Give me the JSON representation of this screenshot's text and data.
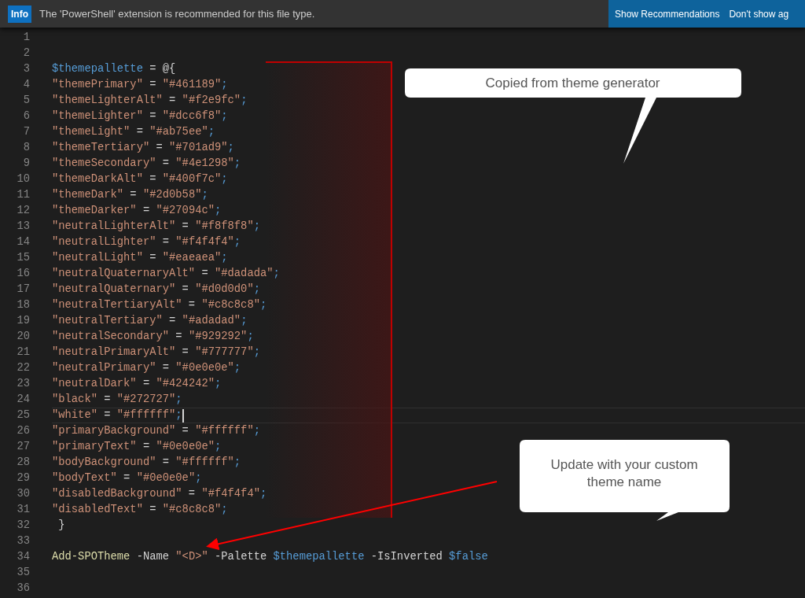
{
  "notification": {
    "badge": "Info",
    "message": "The 'PowerShell' extension is recommended for this file type.",
    "actions": [
      "Show Recommendations",
      "Don't show ag"
    ]
  },
  "editor": {
    "lines": [
      {
        "number": "1",
        "current": false
      },
      {
        "number": "2",
        "current": false
      },
      {
        "number": "3",
        "current": false,
        "tokens": [
          {
            "kind": "variable",
            "text": "$themepallette"
          },
          {
            "kind": "plain",
            "text": " = @{"
          }
        ]
      },
      {
        "number": "4",
        "current": false,
        "tokens": [
          {
            "kind": "string",
            "text": "\"themePrimary\""
          },
          {
            "kind": "plain",
            "text": " = "
          },
          {
            "kind": "string",
            "text": "\"#461189\""
          },
          {
            "kind": "punct",
            "text": ";"
          }
        ]
      },
      {
        "number": "5",
        "current": false,
        "tokens": [
          {
            "kind": "string",
            "text": "\"themeLighterAlt\""
          },
          {
            "kind": "plain",
            "text": " = "
          },
          {
            "kind": "string",
            "text": "\"#f2e9fc\""
          },
          {
            "kind": "punct",
            "text": ";"
          }
        ]
      },
      {
        "number": "6",
        "current": false,
        "tokens": [
          {
            "kind": "string",
            "text": "\"themeLighter\""
          },
          {
            "kind": "plain",
            "text": " = "
          },
          {
            "kind": "string",
            "text": "\"#dcc6f8\""
          },
          {
            "kind": "punct",
            "text": ";"
          }
        ]
      },
      {
        "number": "7",
        "current": false,
        "tokens": [
          {
            "kind": "string",
            "text": "\"themeLight\""
          },
          {
            "kind": "plain",
            "text": " = "
          },
          {
            "kind": "string",
            "text": "\"#ab75ee\""
          },
          {
            "kind": "punct",
            "text": ";"
          }
        ]
      },
      {
        "number": "8",
        "current": false,
        "tokens": [
          {
            "kind": "string",
            "text": "\"themeTertiary\""
          },
          {
            "kind": "plain",
            "text": " = "
          },
          {
            "kind": "string",
            "text": "\"#701ad9\""
          },
          {
            "kind": "punct",
            "text": ";"
          }
        ]
      },
      {
        "number": "9",
        "current": false,
        "tokens": [
          {
            "kind": "string",
            "text": "\"themeSecondary\""
          },
          {
            "kind": "plain",
            "text": " = "
          },
          {
            "kind": "string",
            "text": "\"#4e1298\""
          },
          {
            "kind": "punct",
            "text": ";"
          }
        ]
      },
      {
        "number": "10",
        "current": false,
        "tokens": [
          {
            "kind": "string",
            "text": "\"themeDarkAlt\""
          },
          {
            "kind": "plain",
            "text": " = "
          },
          {
            "kind": "string",
            "text": "\"#400f7c\""
          },
          {
            "kind": "punct",
            "text": ";"
          }
        ]
      },
      {
        "number": "11",
        "current": false,
        "tokens": [
          {
            "kind": "string",
            "text": "\"themeDark\""
          },
          {
            "kind": "plain",
            "text": " = "
          },
          {
            "kind": "string",
            "text": "\"#2d0b58\""
          },
          {
            "kind": "punct",
            "text": ";"
          }
        ]
      },
      {
        "number": "12",
        "current": false,
        "tokens": [
          {
            "kind": "string",
            "text": "\"themeDarker\""
          },
          {
            "kind": "plain",
            "text": " = "
          },
          {
            "kind": "string",
            "text": "\"#27094c\""
          },
          {
            "kind": "punct",
            "text": ";"
          }
        ]
      },
      {
        "number": "13",
        "current": false,
        "tokens": [
          {
            "kind": "string",
            "text": "\"neutralLighterAlt\""
          },
          {
            "kind": "plain",
            "text": " = "
          },
          {
            "kind": "string",
            "text": "\"#f8f8f8\""
          },
          {
            "kind": "punct",
            "text": ";"
          }
        ]
      },
      {
        "number": "14",
        "current": false,
        "tokens": [
          {
            "kind": "string",
            "text": "\"neutralLighter\""
          },
          {
            "kind": "plain",
            "text": " = "
          },
          {
            "kind": "string",
            "text": "\"#f4f4f4\""
          },
          {
            "kind": "punct",
            "text": ";"
          }
        ]
      },
      {
        "number": "15",
        "current": false,
        "tokens": [
          {
            "kind": "string",
            "text": "\"neutralLight\""
          },
          {
            "kind": "plain",
            "text": " = "
          },
          {
            "kind": "string",
            "text": "\"#eaeaea\""
          },
          {
            "kind": "punct",
            "text": ";"
          }
        ]
      },
      {
        "number": "16",
        "current": false,
        "tokens": [
          {
            "kind": "string",
            "text": "\"neutralQuaternaryAlt\""
          },
          {
            "kind": "plain",
            "text": " = "
          },
          {
            "kind": "string",
            "text": "\"#dadada\""
          },
          {
            "kind": "punct",
            "text": ";"
          }
        ]
      },
      {
        "number": "17",
        "current": false,
        "tokens": [
          {
            "kind": "string",
            "text": "\"neutralQuaternary\""
          },
          {
            "kind": "plain",
            "text": " = "
          },
          {
            "kind": "string",
            "text": "\"#d0d0d0\""
          },
          {
            "kind": "punct",
            "text": ";"
          }
        ]
      },
      {
        "number": "18",
        "current": false,
        "tokens": [
          {
            "kind": "string",
            "text": "\"neutralTertiaryAlt\""
          },
          {
            "kind": "plain",
            "text": " = "
          },
          {
            "kind": "string",
            "text": "\"#c8c8c8\""
          },
          {
            "kind": "punct",
            "text": ";"
          }
        ]
      },
      {
        "number": "19",
        "current": false,
        "tokens": [
          {
            "kind": "string",
            "text": "\"neutralTertiary\""
          },
          {
            "kind": "plain",
            "text": " = "
          },
          {
            "kind": "string",
            "text": "\"#adadad\""
          },
          {
            "kind": "punct",
            "text": ";"
          }
        ]
      },
      {
        "number": "20",
        "current": false,
        "tokens": [
          {
            "kind": "string",
            "text": "\"neutralSecondary\""
          },
          {
            "kind": "plain",
            "text": " = "
          },
          {
            "kind": "string",
            "text": "\"#929292\""
          },
          {
            "kind": "punct",
            "text": ";"
          }
        ]
      },
      {
        "number": "21",
        "current": false,
        "tokens": [
          {
            "kind": "string",
            "text": "\"neutralPrimaryAlt\""
          },
          {
            "kind": "plain",
            "text": " = "
          },
          {
            "kind": "string",
            "text": "\"#777777\""
          },
          {
            "kind": "punct",
            "text": ";"
          }
        ]
      },
      {
        "number": "22",
        "current": false,
        "tokens": [
          {
            "kind": "string",
            "text": "\"neutralPrimary\""
          },
          {
            "kind": "plain",
            "text": " = "
          },
          {
            "kind": "string",
            "text": "\"#0e0e0e\""
          },
          {
            "kind": "punct",
            "text": ";"
          }
        ]
      },
      {
        "number": "23",
        "current": false,
        "tokens": [
          {
            "kind": "string",
            "text": "\"neutralDark\""
          },
          {
            "kind": "plain",
            "text": " = "
          },
          {
            "kind": "string",
            "text": "\"#424242\""
          },
          {
            "kind": "punct",
            "text": ";"
          }
        ]
      },
      {
        "number": "24",
        "current": false,
        "tokens": [
          {
            "kind": "string",
            "text": "\"black\""
          },
          {
            "kind": "plain",
            "text": " = "
          },
          {
            "kind": "string",
            "text": "\"#272727\""
          },
          {
            "kind": "punct",
            "text": ";"
          }
        ]
      },
      {
        "number": "25",
        "current": true,
        "tokens": [
          {
            "kind": "string",
            "text": "\"white\""
          },
          {
            "kind": "plain",
            "text": " = "
          },
          {
            "kind": "string",
            "text": "\"#ffffff\""
          },
          {
            "kind": "punct",
            "text": ";"
          }
        ]
      },
      {
        "number": "26",
        "current": false,
        "tokens": [
          {
            "kind": "string",
            "text": "\"primaryBackground\""
          },
          {
            "kind": "plain",
            "text": " = "
          },
          {
            "kind": "string",
            "text": "\"#ffffff\""
          },
          {
            "kind": "punct",
            "text": ";"
          }
        ]
      },
      {
        "number": "27",
        "current": false,
        "tokens": [
          {
            "kind": "string",
            "text": "\"primaryText\""
          },
          {
            "kind": "plain",
            "text": " = "
          },
          {
            "kind": "string",
            "text": "\"#0e0e0e\""
          },
          {
            "kind": "punct",
            "text": ";"
          }
        ]
      },
      {
        "number": "28",
        "current": false,
        "tokens": [
          {
            "kind": "string",
            "text": "\"bodyBackground\""
          },
          {
            "kind": "plain",
            "text": " = "
          },
          {
            "kind": "string",
            "text": "\"#ffffff\""
          },
          {
            "kind": "punct",
            "text": ";"
          }
        ]
      },
      {
        "number": "29",
        "current": false,
        "tokens": [
          {
            "kind": "string",
            "text": "\"bodyText\""
          },
          {
            "kind": "plain",
            "text": " = "
          },
          {
            "kind": "string",
            "text": "\"#0e0e0e\""
          },
          {
            "kind": "punct",
            "text": ";"
          }
        ]
      },
      {
        "number": "30",
        "current": false,
        "tokens": [
          {
            "kind": "string",
            "text": "\"disabledBackground\""
          },
          {
            "kind": "plain",
            "text": " = "
          },
          {
            "kind": "string",
            "text": "\"#f4f4f4\""
          },
          {
            "kind": "punct",
            "text": ";"
          }
        ]
      },
      {
        "number": "31",
        "current": false,
        "tokens": [
          {
            "kind": "string",
            "text": "\"disabledText\""
          },
          {
            "kind": "plain",
            "text": " = "
          },
          {
            "kind": "string",
            "text": "\"#c8c8c8\""
          },
          {
            "kind": "punct",
            "text": ";"
          }
        ]
      },
      {
        "number": "32",
        "current": false,
        "tokens": [
          {
            "kind": "plain",
            "text": " }"
          }
        ]
      },
      {
        "number": "33",
        "current": false
      },
      {
        "number": "34",
        "current": false,
        "tokens": [
          {
            "kind": "command",
            "text": "Add-SPOTheme"
          },
          {
            "kind": "plain",
            "text": " -Name "
          },
          {
            "kind": "string",
            "text": "\"<D>\""
          },
          {
            "kind": "plain",
            "text": " -Palette "
          },
          {
            "kind": "variable",
            "text": "$themepallette"
          },
          {
            "kind": "plain",
            "text": " -IsInverted "
          },
          {
            "kind": "variable",
            "text": "$false"
          }
        ]
      },
      {
        "number": "35",
        "current": false
      },
      {
        "number": "36",
        "current": false
      }
    ]
  },
  "callouts": [
    "Copied from theme generator",
    "Update with your custom theme name"
  ]
}
